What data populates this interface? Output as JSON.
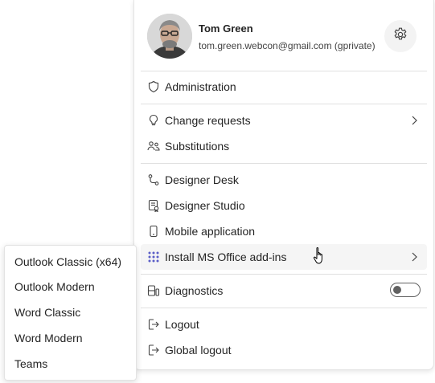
{
  "user": {
    "name": "Tom Green",
    "email": "tom.green.webcon@gmail.com (gprivate)"
  },
  "menu": {
    "items": [
      {
        "label": "Administration",
        "icon": "shield-icon"
      },
      {
        "label": "Change requests",
        "icon": "lightbulb-icon"
      },
      {
        "label": "Substitutions",
        "icon": "people-swap-icon"
      },
      {
        "label": "Designer Desk",
        "icon": "flow-icon"
      },
      {
        "label": "Designer Studio",
        "icon": "document-ribbon-icon"
      },
      {
        "label": "Mobile application",
        "icon": "phone-icon"
      },
      {
        "label": "Install MS Office add-ins",
        "icon": "app-grid-icon"
      },
      {
        "label": "Diagnostics",
        "icon": "diagnostics-icon"
      },
      {
        "label": "Logout",
        "icon": "sign-out-icon"
      },
      {
        "label": "Global logout",
        "icon": "sign-out-icon"
      }
    ]
  },
  "diagnostics_toggle": {
    "on": false
  },
  "submenu": {
    "items": [
      "Outlook Classic (x64)",
      "Outlook Modern",
      "Word Classic",
      "Word Modern",
      "Teams"
    ]
  },
  "colors": {
    "accent": "#5b5fc7",
    "text": "#242424",
    "hover": "#f5f5f5"
  }
}
